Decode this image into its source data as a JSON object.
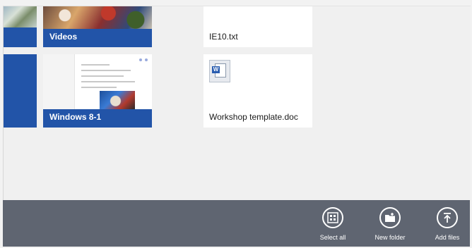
{
  "tiles": {
    "videos": {
      "label": "Videos",
      "accent": "#2254a8"
    },
    "windows": {
      "label": "Windows 8-1",
      "accent": "#2254a8"
    },
    "ie10": {
      "label": "IE10.txt"
    },
    "workshop": {
      "label": "Workshop template.doc",
      "icon": "word-document-icon"
    }
  },
  "appbar": {
    "background": "#5f6571",
    "commands": [
      {
        "label": "Select all",
        "icon": "select-all-icon"
      },
      {
        "label": "New folder",
        "icon": "new-folder-icon"
      },
      {
        "label": "Add files",
        "icon": "add-files-icon"
      }
    ]
  }
}
